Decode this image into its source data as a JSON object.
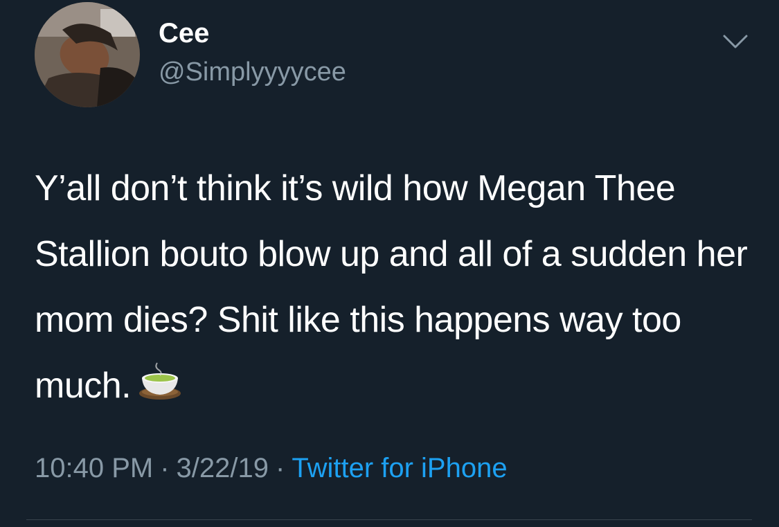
{
  "user": {
    "display_name": "Cee",
    "handle": "@Simplyyyycee"
  },
  "icons": {
    "avatar": "profile-photo",
    "menu": "chevron-down-icon",
    "emoji": "teacup-without-handle-emoji"
  },
  "tweet": {
    "text": "Y’all don’t think it’s wild how Megan Thee Stallion bouto blow up and all of a sudden her mom dies? Shit like this happens way too much."
  },
  "meta": {
    "time": "10:40 PM",
    "separator": "·",
    "date": "3/22/19",
    "source": "Twitter for iPhone"
  },
  "colors": {
    "background": "#15202b",
    "text": "#ffffff",
    "secondary_text": "#8899a6",
    "link": "#1da1f2",
    "divider": "#38444d"
  }
}
